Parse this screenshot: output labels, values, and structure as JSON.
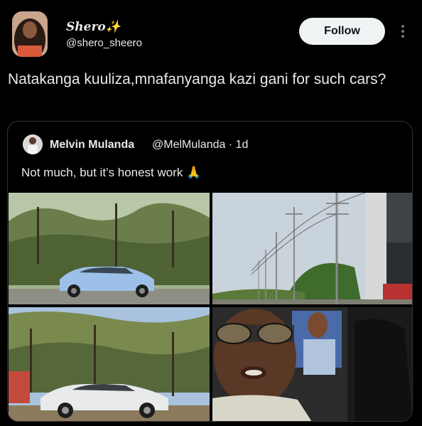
{
  "author": {
    "display_name": "Shero✨",
    "handle": "@shero_sheero"
  },
  "follow_label": "Follow",
  "post_text": "Natakanga kuuliza,mnafanyanga kazi gani for such cars?",
  "quoted_post": {
    "name": "Melvin Mulanda",
    "handle_time": "@MelMulanda · 1d",
    "text": "Not much, but it’s honest work 🙏",
    "photos": [
      {
        "subject": "light-blue-coupe-under-acacia-trees"
      },
      {
        "subject": "power-lines-along-road"
      },
      {
        "subject": "silver-coupe-under-acacia-trees"
      },
      {
        "subject": "man-in-sunglasses-selfie-in-car"
      }
    ]
  },
  "icons": {
    "more": "more-vertical-icon"
  }
}
